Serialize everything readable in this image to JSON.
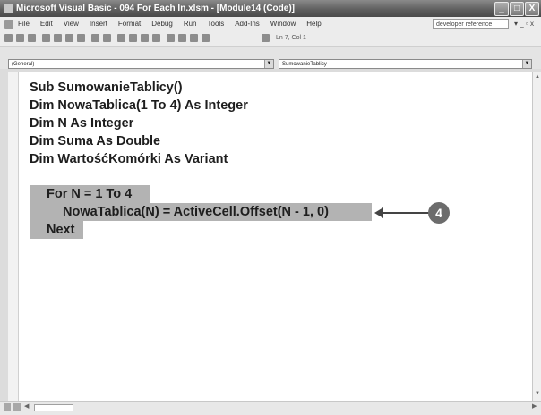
{
  "window": {
    "title": "Microsoft Visual Basic - 094 For Each In.xlsm - [Module14 (Code)]",
    "controls": [
      "_",
      "□",
      "X"
    ]
  },
  "menu": {
    "items": [
      "File",
      "Edit",
      "View",
      "Insert",
      "Format",
      "Debug",
      "Run",
      "Tools",
      "Add-Ins",
      "Window",
      "Help"
    ],
    "help_box": "developer reference",
    "doc_controls": "▾ _ ▫ x"
  },
  "toolbar": {
    "position_text": "Ln 7, Col 1"
  },
  "combos": {
    "object": "(General)",
    "procedure": "SumowanieTablicy"
  },
  "code": {
    "lines": [
      "Sub SumowanieTablicy()",
      "Dim NowaTablica(1 To 4) As Integer",
      "Dim N As Integer",
      "Dim Suma As Double",
      "Dim WartośćKomórki As Variant",
      "For N = 1 To 4",
      "NowaTablica(N) = ActiveCell.Offset(N - 1, 0)",
      "Next"
    ]
  },
  "callout": {
    "number": "4"
  }
}
